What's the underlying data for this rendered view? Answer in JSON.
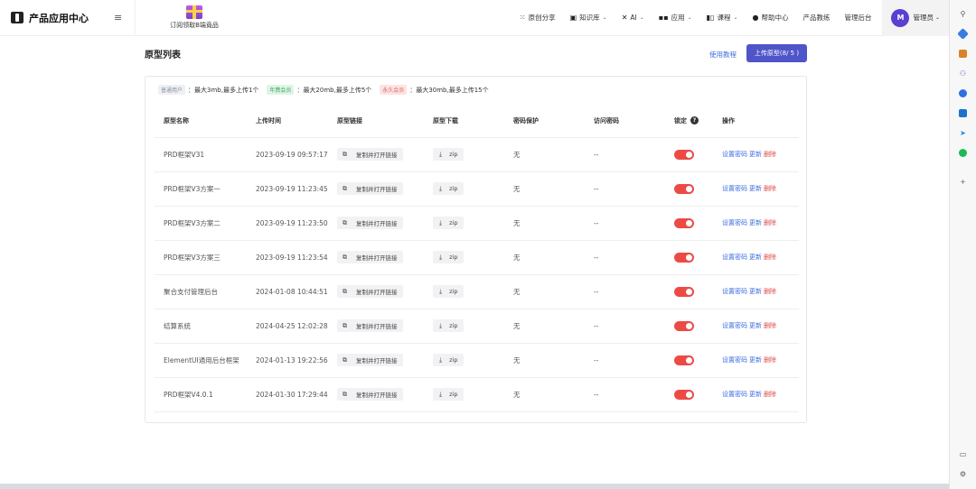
{
  "header": {
    "brand": "产品应用中心",
    "promo": "订阅领取B端竟品",
    "nav": [
      {
        "label": "原创分享",
        "icon": "grid-icon",
        "caret": false
      },
      {
        "label": "知识库",
        "icon": "book-icon",
        "caret": true
      },
      {
        "label": "AI",
        "icon": "ai-tools-icon",
        "caret": true
      },
      {
        "label": "应用",
        "icon": "apps-icon",
        "caret": true
      },
      {
        "label": "课程",
        "icon": "course-icon",
        "caret": true
      },
      {
        "label": "帮助中心",
        "icon": "chat-icon",
        "caret": false
      },
      {
        "label": "产品教练",
        "icon": "",
        "caret": false
      },
      {
        "label": "管理后台",
        "icon": "",
        "caret": false
      }
    ],
    "admin": {
      "avatar": "M",
      "label": "管理员"
    }
  },
  "page": {
    "title": "原型列表",
    "tutorial": "使用教程",
    "upload": "上传原型(8/ 5 )"
  },
  "limits": [
    {
      "tag": "普通用户",
      "text": "最大3mb,最多上传1个"
    },
    {
      "tag": "年费会员",
      "text": "最大20mb,最多上传5个"
    },
    {
      "tag": "永久会员",
      "text": "最大30mb,最多上传15个"
    }
  ],
  "limit_colon": "：",
  "table": {
    "headers": [
      "原型名称",
      "上传时间",
      "原型链接",
      "原型下载",
      "密码保护",
      "访问密码",
      "锁定",
      "操作"
    ],
    "copy_label": "复制并打开链接",
    "zip_label": "zip",
    "ops": {
      "set_password": "设置密码",
      "update": "更新",
      "delete": "删除"
    },
    "rows": [
      {
        "name": "PRD框架V31",
        "time": "2023-09-19 09:57:17",
        "protect": "无",
        "password": "--",
        "locked": true
      },
      {
        "name": "PRD框架V3方案一",
        "time": "2023-09-19 11:23:45",
        "protect": "无",
        "password": "--",
        "locked": true
      },
      {
        "name": "PRD框架V3方案二",
        "time": "2023-09-19 11:23:50",
        "protect": "无",
        "password": "--",
        "locked": true
      },
      {
        "name": "PRD框架V3方案三",
        "time": "2023-09-19 11:23:54",
        "protect": "无",
        "password": "--",
        "locked": true
      },
      {
        "name": "聚合支付管理后台",
        "time": "2024-01-08 10:44:51",
        "protect": "无",
        "password": "--",
        "locked": true
      },
      {
        "name": "结算系统",
        "time": "2024-04-25 12:02:28",
        "protect": "无",
        "password": "--",
        "locked": true
      },
      {
        "name": "ElementUI通用后台框架",
        "time": "2024-01-13 19:22:56",
        "protect": "无",
        "password": "--",
        "locked": true
      },
      {
        "name": "PRD框架V4.0.1",
        "time": "2024-01-30 17:29:44",
        "protect": "无",
        "password": "--",
        "locked": true
      }
    ]
  },
  "colors": {
    "accent": "#4f55c9",
    "link": "#3d6ee0",
    "danger": "#e04848",
    "toggle_on": "#ec4b45"
  }
}
